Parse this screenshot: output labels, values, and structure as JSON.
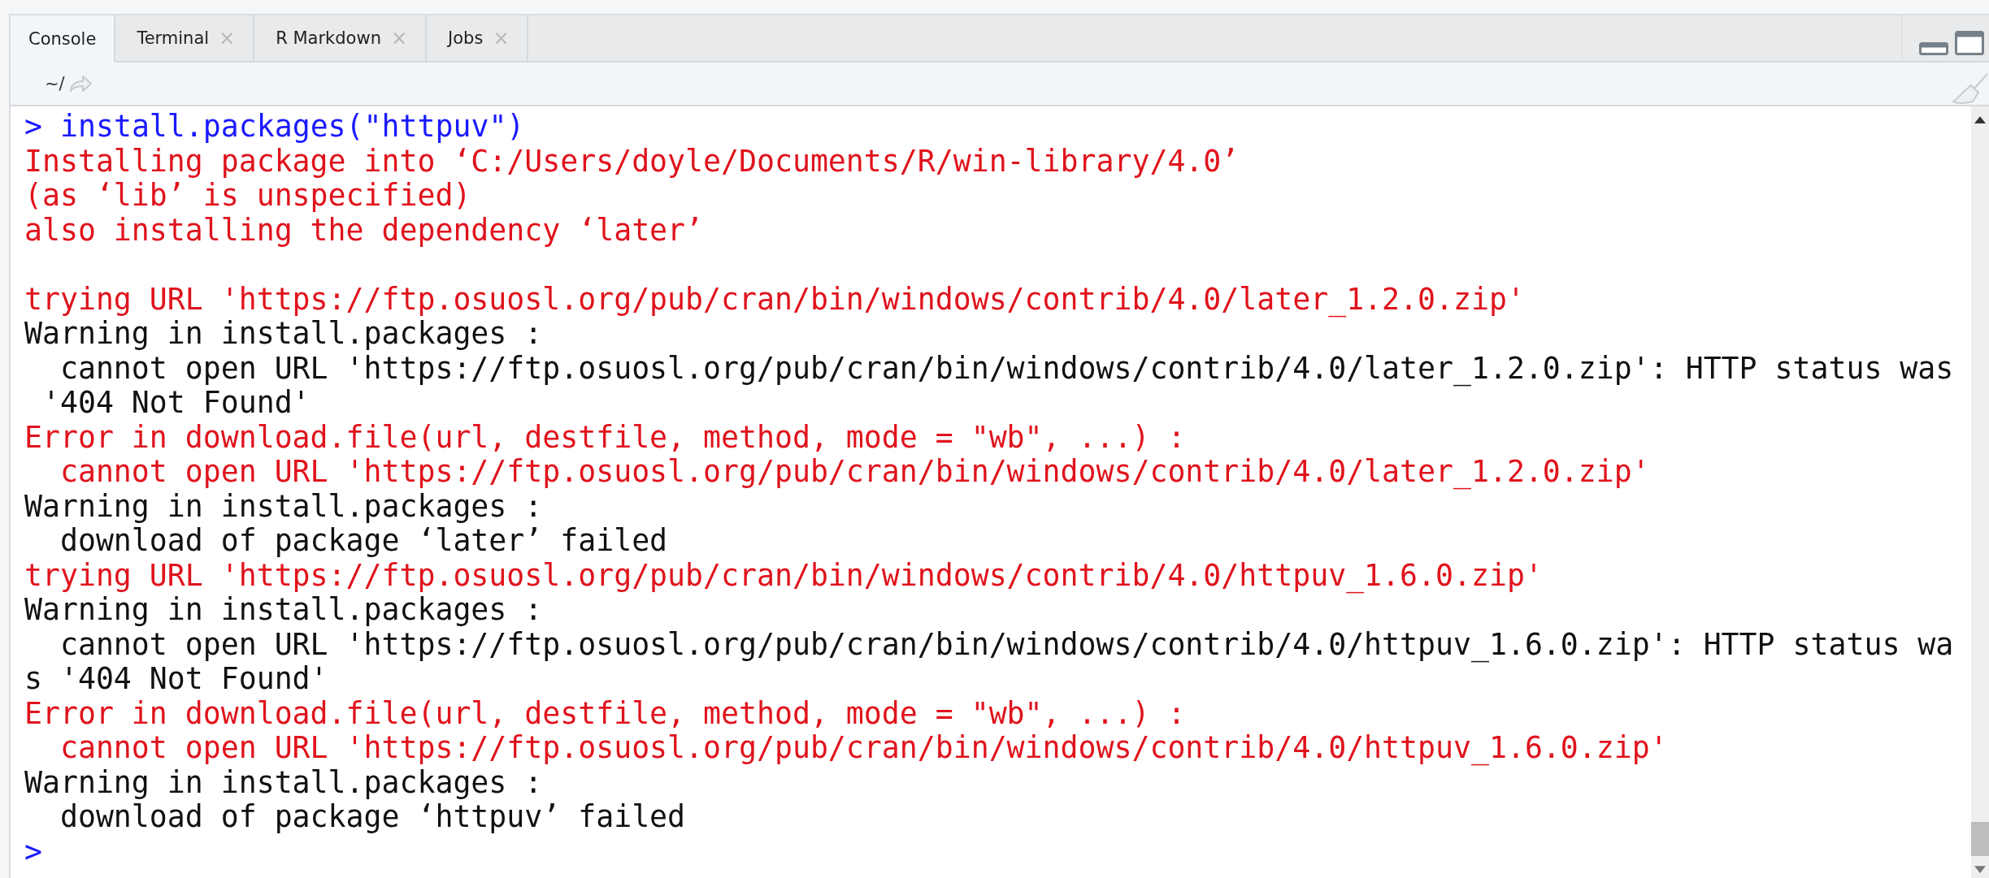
{
  "tabs": [
    {
      "label": "Console",
      "selected": true
    },
    {
      "label": "Terminal",
      "selected": false,
      "close": "×"
    },
    {
      "label": "R Markdown",
      "selected": false,
      "close": "×"
    },
    {
      "label": "Jobs",
      "selected": false,
      "close": "×"
    }
  ],
  "path": "~/",
  "console_lines": [
    {
      "kind": "input",
      "prompt": ">",
      "text": "install.packages(\"httpuv\")"
    },
    {
      "kind": "message",
      "text": "Installing package into ‘C:/Users/doyle/Documents/R/win-library/4.0’"
    },
    {
      "kind": "message",
      "text": "(as ‘lib’ is unspecified)"
    },
    {
      "kind": "message",
      "text": "also installing the dependency ‘later’"
    },
    {
      "kind": "blank"
    },
    {
      "kind": "message",
      "text": "trying URL 'https://ftp.osuosl.org/pub/cran/bin/windows/contrib/4.0/later_1.2.0.zip'"
    },
    {
      "kind": "output",
      "text": "Warning in install.packages :"
    },
    {
      "kind": "output",
      "text": "  cannot open URL 'https://ftp.osuosl.org/pub/cran/bin/windows/contrib/4.0/later_1.2.0.zip': HTTP status was"
    },
    {
      "kind": "output",
      "text": " '404 Not Found'"
    },
    {
      "kind": "message",
      "text": "Error in download.file(url, destfile, method, mode = \"wb\", ...) :"
    },
    {
      "kind": "message",
      "text": "  cannot open URL 'https://ftp.osuosl.org/pub/cran/bin/windows/contrib/4.0/later_1.2.0.zip'"
    },
    {
      "kind": "output",
      "text": "Warning in install.packages :"
    },
    {
      "kind": "output",
      "text": "  download of package ‘later’ failed"
    },
    {
      "kind": "message",
      "text": "trying URL 'https://ftp.osuosl.org/pub/cran/bin/windows/contrib/4.0/httpuv_1.6.0.zip'"
    },
    {
      "kind": "output",
      "text": "Warning in install.packages :"
    },
    {
      "kind": "output",
      "text": "  cannot open URL 'https://ftp.osuosl.org/pub/cran/bin/windows/contrib/4.0/httpuv_1.6.0.zip': HTTP status wa"
    },
    {
      "kind": "output",
      "text": "s '404 Not Found'"
    },
    {
      "kind": "message",
      "text": "Error in download.file(url, destfile, method, mode = \"wb\", ...) :"
    },
    {
      "kind": "message",
      "text": "  cannot open URL 'https://ftp.osuosl.org/pub/cran/bin/windows/contrib/4.0/httpuv_1.6.0.zip'"
    },
    {
      "kind": "output",
      "text": "Warning in install.packages :"
    },
    {
      "kind": "output",
      "text": "  download of package ‘httpuv’ failed"
    },
    {
      "kind": "prompt",
      "prompt": ">"
    }
  ]
}
